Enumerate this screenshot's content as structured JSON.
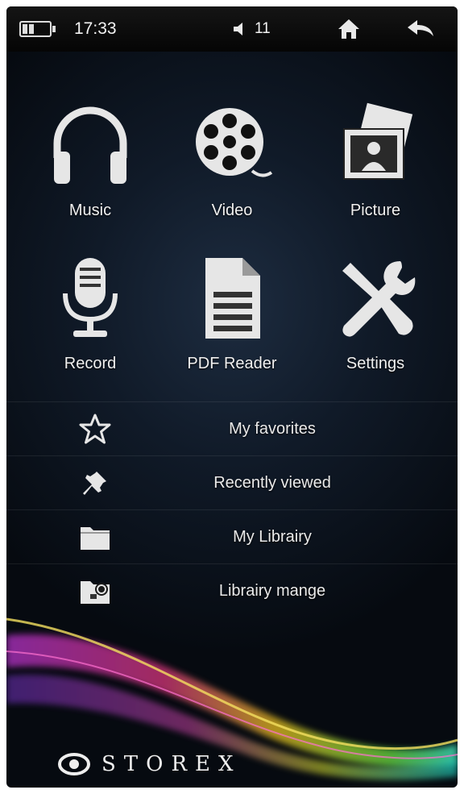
{
  "status_bar": {
    "time": "17:33",
    "volume": "11"
  },
  "apps": [
    {
      "label": "Music",
      "icon": "headphones-icon"
    },
    {
      "label": "Video",
      "icon": "film-reel-icon"
    },
    {
      "label": "Picture",
      "icon": "picture-icon"
    },
    {
      "label": "Record",
      "icon": "microphone-icon"
    },
    {
      "label": "PDF Reader",
      "icon": "document-icon"
    },
    {
      "label": "Settings",
      "icon": "wrench-screwdriver-icon"
    }
  ],
  "menu": [
    {
      "label": "My favorites",
      "icon": "star-icon"
    },
    {
      "label": "Recently viewed",
      "icon": "pin-icon"
    },
    {
      "label": "My Librairy",
      "icon": "folder-icon"
    },
    {
      "label": "Librairy mange",
      "icon": "folder-settings-icon"
    }
  ],
  "brand": {
    "name": "STOREX",
    "icon": "storex-logo-icon"
  },
  "colors": {
    "background": "#0b1320",
    "text": "#f0f0f0",
    "icon": "#e6e6e6"
  }
}
